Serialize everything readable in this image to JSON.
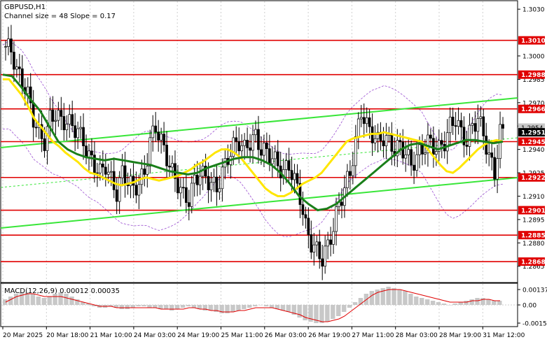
{
  "header": {
    "symbol": "GBPUSD,H1",
    "channel": "Channel size = 48 Slope = 0.17"
  },
  "macd_label": "MACD(12,26,9) 0.00012 0.00035",
  "colors": {
    "background": "#ffffff",
    "candle": "#000000",
    "level_line": "#e00000",
    "level_box": "#e00000",
    "ma_fast": "#ffe600",
    "ma_slow": "#1a7f1a",
    "channel": "#39e639",
    "bands": "#9b4fd1",
    "price_box": "#000000",
    "macd_hist": "#c8c8c8",
    "macd_signal": "#e00000"
  },
  "price_axis": {
    "ticks": [
      "1.3030",
      "1.3000",
      "1.2985",
      "1.2970",
      "1.2955",
      "1.2940",
      "1.2925",
      "1.2910",
      "1.2895",
      "1.2880",
      "1.2865"
    ],
    "highlighted_levels": [
      "1.3010",
      "1.2988",
      "1.2966",
      "1.2945",
      "1.2922",
      "1.2901",
      "1.2885",
      "1.2868"
    ],
    "current_price": "1.2951",
    "upper_price": "1.2954"
  },
  "macd_axis": {
    "ticks": [
      "0.00137",
      "0.00",
      "-0.00156"
    ]
  },
  "time_axis": {
    "labels": [
      "20 Mar 2025",
      "20 Mar 18:00",
      "21 Mar 10:00",
      "24 Mar 03:00",
      "24 Mar 19:00",
      "25 Mar 11:00",
      "26 Mar 03:00",
      "26 Mar 19:00",
      "27 Mar 11:00",
      "28 Mar 03:00",
      "28 Mar 19:00",
      "31 Mar 12:00"
    ]
  },
  "chart_data": {
    "type": "candlestick",
    "title": "GBPUSD,H1",
    "subtitle": "Channel size = 48 Slope = 0.17",
    "y_range": [
      1.2855,
      1.3035
    ],
    "support_resistance": [
      1.301,
      1.2988,
      1.2966,
      1.2945,
      1.2922,
      1.2901,
      1.2885,
      1.2868
    ],
    "close_path": [
      1.3006,
      1.3004,
      1.299,
      1.2984,
      1.2975,
      1.296,
      1.295,
      1.2945,
      1.296,
      1.2963,
      1.2958,
      1.2958,
      1.2955,
      1.2952,
      1.2945,
      1.2935,
      1.293,
      1.2925,
      1.293,
      1.292,
      1.2912,
      1.2925,
      1.292,
      1.2915,
      1.2918,
      1.2925,
      1.2945,
      1.2955,
      1.2945,
      1.2935,
      1.2925,
      1.2918,
      1.291,
      1.2908,
      1.292,
      1.2925,
      1.2922,
      1.2918,
      1.2915,
      1.2925,
      1.2935,
      1.2942,
      1.2945,
      1.294,
      1.2945,
      1.2948,
      1.294,
      1.2938,
      1.2935,
      1.293,
      1.2925,
      1.293,
      1.292,
      1.291,
      1.289,
      1.288,
      1.2875,
      1.287,
      1.2878,
      1.289,
      1.2905,
      1.2915,
      1.2925,
      1.2945,
      1.2965,
      1.2955,
      1.295,
      1.2945,
      1.2948,
      1.2945,
      1.294,
      1.2942,
      1.2938,
      1.293,
      1.2935,
      1.294,
      1.2945,
      1.2942,
      1.294,
      1.2945,
      1.2955,
      1.296,
      1.295,
      1.2945,
      1.2955,
      1.296,
      1.295,
      1.2935,
      1.2925,
      1.2951
    ],
    "ma_fast_path": [
      1.2985,
      1.2985,
      1.298,
      1.2975,
      1.2968,
      1.296,
      1.2955,
      1.295,
      1.2945,
      1.2942,
      1.2938,
      1.2935,
      1.2932,
      1.2928,
      1.2925,
      1.2924,
      1.2922,
      1.292,
      1.2918,
      1.2917,
      1.2918,
      1.2919,
      1.2921,
      1.2922,
      1.2921,
      1.292,
      1.2921,
      1.2922,
      1.2923,
      1.2925,
      1.2927,
      1.293,
      1.2932,
      1.2935,
      1.2938,
      1.294,
      1.294,
      1.2938,
      1.2935,
      1.293,
      1.2925,
      1.292,
      1.2915,
      1.2912,
      1.291,
      1.291,
      1.2912,
      1.2915,
      1.2918,
      1.292,
      1.2922,
      1.2925,
      1.293,
      1.2935,
      1.294,
      1.2945,
      1.2947,
      1.2948,
      1.2949,
      1.295,
      1.295,
      1.2951,
      1.295,
      1.2949,
      1.2948,
      1.2947,
      1.2946,
      1.2945,
      1.294,
      1.2935,
      1.293,
      1.2926,
      1.2925,
      1.2928,
      1.2932,
      1.2936,
      1.294,
      1.2943,
      1.2945,
      1.2946,
      1.2945
    ],
    "ma_slow_path": [
      1.2988,
      1.2987,
      1.298,
      1.2972,
      1.2965,
      1.2955,
      1.2945,
      1.294,
      1.2937,
      1.2935,
      1.2934,
      1.2933,
      1.2934,
      1.2933,
      1.2932,
      1.2931,
      1.293,
      1.2928,
      1.2926,
      1.2925,
      1.2924,
      1.2925,
      1.2928,
      1.293,
      1.2932,
      1.2934,
      1.2935,
      1.2935,
      1.2933,
      1.293,
      1.2925,
      1.2918,
      1.291,
      1.2905,
      1.2901,
      1.2902,
      1.2905,
      1.291,
      1.2915,
      1.292,
      1.2925,
      1.293,
      1.2935,
      1.294,
      1.2943,
      1.2944,
      1.2942,
      1.294,
      1.2942,
      1.2944,
      1.2946,
      1.2946,
      1.2945,
      1.2944,
      1.2945
    ],
    "macd_hist": [
      4e-05,
      6e-05,
      8e-05,
      9e-05,
      9e-05,
      8e-05,
      6e-05,
      5e-05,
      6e-05,
      8e-05,
      9e-05,
      8e-05,
      6e-05,
      4e-05,
      2e-05,
      1e-05,
      -1e-05,
      -2e-05,
      -2e-05,
      -1e-05,
      -2e-05,
      -3e-05,
      -3e-05,
      -2e-05,
      -1e-05,
      -1e-05,
      -2e-05,
      -2e-05,
      -3e-05,
      -3e-05,
      -4e-05,
      -3e-05,
      -2e-05,
      -1e-05,
      -2e-05,
      -3e-05,
      -4e-05,
      -4e-05,
      -5e-05,
      -6e-05,
      -6e-05,
      -5e-05,
      -4e-05,
      -3e-05,
      -2e-05,
      -1e-05,
      0.0,
      -1e-05,
      -2e-05,
      -3e-05,
      -4e-05,
      -5e-05,
      -7e-05,
      -9e-05,
      -0.00011,
      -0.00012,
      -0.00013,
      -0.00013,
      -0.00012,
      -0.0001,
      -8e-05,
      -5e-05,
      -2e-05,
      2e-05,
      5e-05,
      8e-05,
      0.0001,
      0.00011,
      0.00012,
      0.00013,
      0.00012,
      0.00011,
      0.0001,
      8e-05,
      6e-05,
      5e-05,
      4e-05,
      3e-05,
      2e-05,
      1e-05,
      0.0,
      1e-05,
      2e-05,
      3e-05,
      4e-05,
      5e-05,
      5e-05,
      4e-05,
      3e-05,
      3e-05
    ],
    "macd_signal": [
      2e-05,
      4e-05,
      6e-05,
      7e-05,
      8e-05,
      8e-05,
      7e-05,
      6e-05,
      6e-05,
      6e-05,
      6e-05,
      5e-05,
      4e-05,
      3e-05,
      2e-05,
      1e-05,
      0.0,
      -1e-05,
      -1e-05,
      -1e-05,
      -2e-05,
      -2e-05,
      -2e-05,
      -2e-05,
      -2e-05,
      -2e-05,
      -2e-05,
      -2e-05,
      -3e-05,
      -3e-05,
      -3e-05,
      -3e-05,
      -3e-05,
      -2e-05,
      -2e-05,
      -3e-05,
      -3e-05,
      -4e-05,
      -4e-05,
      -5e-05,
      -5e-05,
      -5e-05,
      -4e-05,
      -4e-05,
      -3e-05,
      -2e-05,
      -2e-05,
      -2e-05,
      -2e-05,
      -3e-05,
      -4e-05,
      -5e-05,
      -6e-05,
      -7e-05,
      -9e-05,
      -0.0001,
      -0.00011,
      -0.00012,
      -0.00012,
      -0.00011,
      -0.0001,
      -8e-05,
      -5e-05,
      -2e-05,
      1e-05,
      4e-05,
      7e-05,
      9e-05,
      0.0001,
      0.00011,
      0.00011,
      0.00011,
      0.0001,
      9e-05,
      8e-05,
      7e-05,
      6e-05,
      5e-05,
      4e-05,
      3e-05,
      2e-05,
      2e-05,
      2e-05,
      2e-05,
      3e-05,
      3e-05,
      4e-05,
      4e-05,
      3e-05,
      3e-05
    ]
  }
}
